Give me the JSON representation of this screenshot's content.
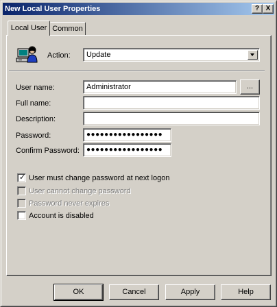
{
  "window": {
    "title": "New Local User Properties",
    "help_button": "?",
    "close_button": "X"
  },
  "tabs": [
    {
      "label": "Local User",
      "active": true
    },
    {
      "label": "Common",
      "active": false
    }
  ],
  "action": {
    "label": "Action:",
    "value": "Update",
    "icon": "user-computer-icon"
  },
  "form": {
    "user_name_label": "User name:",
    "user_name_value": "Administrator",
    "browse_button": "...",
    "full_name_label": "Full name:",
    "full_name_value": "",
    "description_label": "Description:",
    "description_value": "",
    "password_label": "Password:",
    "password_value": "●●●●●●●●●●●●●●●●●",
    "confirm_password_label": "Confirm Password:",
    "confirm_password_value": "●●●●●●●●●●●●●●●●●"
  },
  "options": [
    {
      "label": "User must change password at next logon",
      "checked": true,
      "enabled": true
    },
    {
      "label": "User cannot change password",
      "checked": false,
      "enabled": false
    },
    {
      "label": "Password never expires",
      "checked": false,
      "enabled": false
    },
    {
      "label": "Account is disabled",
      "checked": false,
      "enabled": true
    }
  ],
  "buttons": {
    "ok": "OK",
    "cancel": "Cancel",
    "apply": "Apply",
    "help": "Help"
  },
  "colors": {
    "title_start": "#0a246a",
    "title_end": "#a6caf0",
    "face": "#d4d0c8"
  }
}
